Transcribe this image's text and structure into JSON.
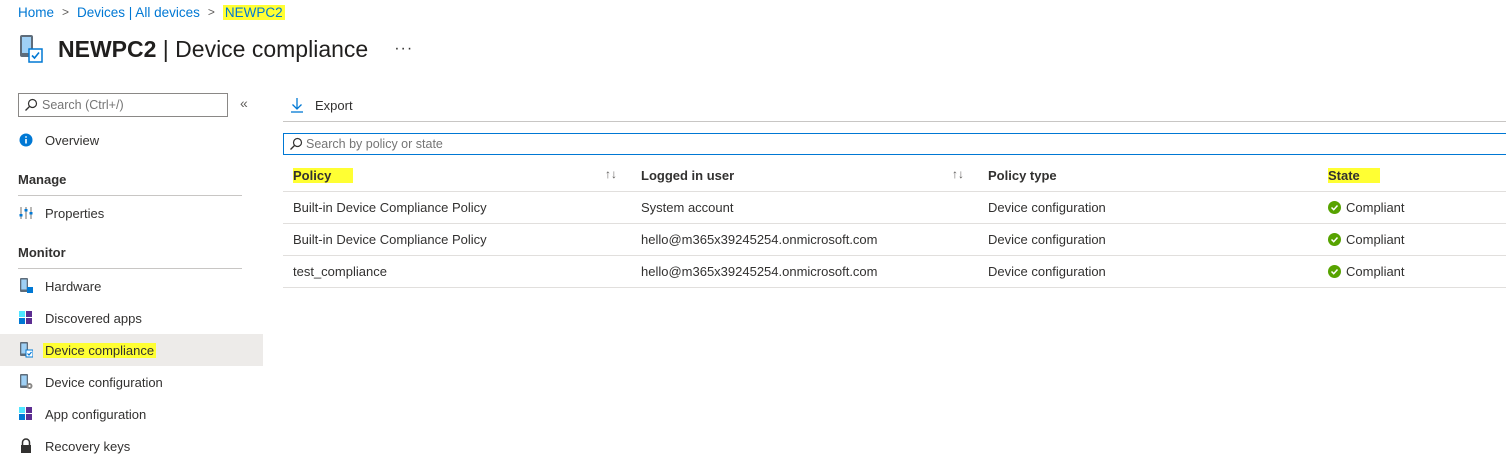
{
  "breadcrumb": {
    "home": "Home",
    "devices": "Devices | All devices",
    "current": "NEWPC2"
  },
  "header": {
    "device_name": "NEWPC2",
    "page_title": " | Device compliance",
    "more": "···"
  },
  "sidebar": {
    "search_placeholder": "Search (Ctrl+/)",
    "collapse": "«",
    "overview": "Overview",
    "manage_heading": "Manage",
    "properties": "Properties",
    "monitor_heading": "Monitor",
    "hardware": "Hardware",
    "discovered_apps": "Discovered apps",
    "device_compliance": "Device compliance",
    "device_configuration": "Device configuration",
    "app_configuration": "App configuration",
    "recovery_keys": "Recovery keys"
  },
  "toolbar": {
    "export": "Export"
  },
  "search": {
    "placeholder": "Search by policy or state"
  },
  "table": {
    "headers": {
      "policy": "Policy",
      "user": "Logged in user",
      "type": "Policy type",
      "state": "State"
    },
    "rows": [
      {
        "policy": "Built-in Device Compliance Policy",
        "user": "System account",
        "type": "Device configuration",
        "state": "Compliant"
      },
      {
        "policy": "Built-in Device Compliance Policy",
        "user": "hello@m365x39245254.onmicrosoft.com",
        "type": "Device configuration",
        "state": "Compliant"
      },
      {
        "policy": "test_compliance",
        "user": "hello@m365x39245254.onmicrosoft.com",
        "type": "Device configuration",
        "state": "Compliant"
      }
    ]
  },
  "colors": {
    "accent": "#0078d4",
    "highlight": "#ffff33",
    "success": "#57a300",
    "selected_bg": "#edebe9"
  }
}
